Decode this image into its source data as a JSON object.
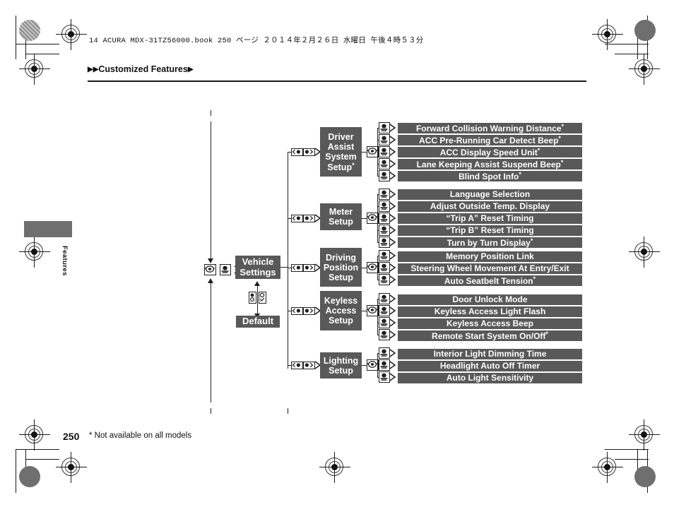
{
  "page": {
    "filestamp": "14 ACURA MDX-31TZ56000.book   250 ページ   ２０１４年２月２６日   水曜日   午後４時５３分",
    "breadcrumb": "Customized Features",
    "breadcrumb_lead": "▶▶",
    "breadcrumb_trail": "▶",
    "side_tab_label": "Features",
    "folio": "250",
    "footnote": "* Not available on all models"
  },
  "chart_data": {
    "type": "diagram",
    "title": "Customized Features menu tree",
    "root": {
      "label": "Vehicle Settings",
      "label_line1": "Vehicle",
      "label_line2": "Settings",
      "icons": [
        "rotary-knob-icon",
        "select-button-icon"
      ]
    },
    "default_node": {
      "label": "Default",
      "icons": [
        "up-down-button-icon",
        "select-check-icon"
      ]
    },
    "groups": [
      {
        "label": "Driver Assist System Setup",
        "label_lines": [
          "Driver",
          "Assist",
          "System",
          "Setup"
        ],
        "asterisk": true,
        "entry_icons": [
          "left-right-button-icon",
          "left-right-button-icon"
        ],
        "node_icon": "rotary-knob-icon",
        "items": [
          {
            "label": "Forward Collision Warning Distance",
            "asterisk": true,
            "icon": "select-button-icon"
          },
          {
            "label": "ACC Pre-Running Car Detect Beep",
            "asterisk": true,
            "icon": "select-button-icon"
          },
          {
            "label": "ACC Display Speed Unit",
            "asterisk": true,
            "icon": "select-button-icon"
          },
          {
            "label": "Lane Keeping Assist Suspend Beep",
            "asterisk": true,
            "icon": "select-button-icon"
          },
          {
            "label": "Blind Spot Info",
            "asterisk": true,
            "icon": "select-button-icon"
          }
        ]
      },
      {
        "label": "Meter Setup",
        "label_lines": [
          "Meter",
          "Setup"
        ],
        "asterisk": false,
        "entry_icons": [
          "left-right-button-icon",
          "left-right-button-icon"
        ],
        "node_icon": "rotary-knob-icon",
        "items": [
          {
            "label": "Language Selection",
            "asterisk": false,
            "icon": "select-button-icon"
          },
          {
            "label": "Adjust Outside Temp. Display",
            "asterisk": false,
            "icon": "select-button-icon"
          },
          {
            "label": "“Trip A” Reset Timing",
            "asterisk": false,
            "icon": "select-button-icon"
          },
          {
            "label": "“Trip B” Reset Timing",
            "asterisk": false,
            "icon": "select-button-icon"
          },
          {
            "label": "Turn by Turn Display",
            "asterisk": true,
            "icon": "select-button-icon"
          }
        ]
      },
      {
        "label": "Driving Position Setup",
        "label_lines": [
          "Driving",
          "Position",
          "Setup"
        ],
        "asterisk": false,
        "entry_icons": [
          "left-right-button-icon",
          "left-right-button-icon"
        ],
        "node_icon": "rotary-knob-icon",
        "items": [
          {
            "label": "Memory Position Link",
            "asterisk": false,
            "icon": "select-button-icon"
          },
          {
            "label": "Steering Wheel Movement At Entry/Exit",
            "asterisk": false,
            "icon": "select-button-icon"
          },
          {
            "label": "Auto Seatbelt Tension",
            "asterisk": true,
            "icon": "select-button-icon"
          }
        ]
      },
      {
        "label": "Keyless Access Setup",
        "label_lines": [
          "Keyless",
          "Access",
          "Setup"
        ],
        "asterisk": false,
        "entry_icons": [
          "left-right-button-icon",
          "left-right-button-icon"
        ],
        "node_icon": "rotary-knob-icon",
        "items": [
          {
            "label": "Door Unlock Mode",
            "asterisk": false,
            "icon": "select-button-icon"
          },
          {
            "label": "Keyless Access Light Flash",
            "asterisk": false,
            "icon": "select-button-icon"
          },
          {
            "label": "Keyless Access Beep",
            "asterisk": false,
            "icon": "select-button-icon"
          },
          {
            "label": "Remote Start System On/Off",
            "asterisk": true,
            "icon": "select-button-icon"
          }
        ]
      },
      {
        "label": "Lighting Setup",
        "label_lines": [
          "Lighting",
          "Setup"
        ],
        "asterisk": false,
        "entry_icons": [
          "left-right-button-icon",
          "left-right-button-icon"
        ],
        "node_icon": "rotary-knob-icon",
        "items": [
          {
            "label": "Interior Light Dimming Time",
            "asterisk": false,
            "icon": "select-button-icon"
          },
          {
            "label": "Headlight Auto Off Timer",
            "asterisk": false,
            "icon": "select-button-icon"
          },
          {
            "label": "Auto Light Sensitivity",
            "asterisk": false,
            "icon": "select-button-icon"
          }
        ]
      }
    ],
    "colors": {
      "box_fill": "#595959",
      "box_text": "#ffffff",
      "line": "#1f1f1f",
      "tab_fill": "#6f6f6f",
      "page_bg": "#ffffff"
    }
  }
}
